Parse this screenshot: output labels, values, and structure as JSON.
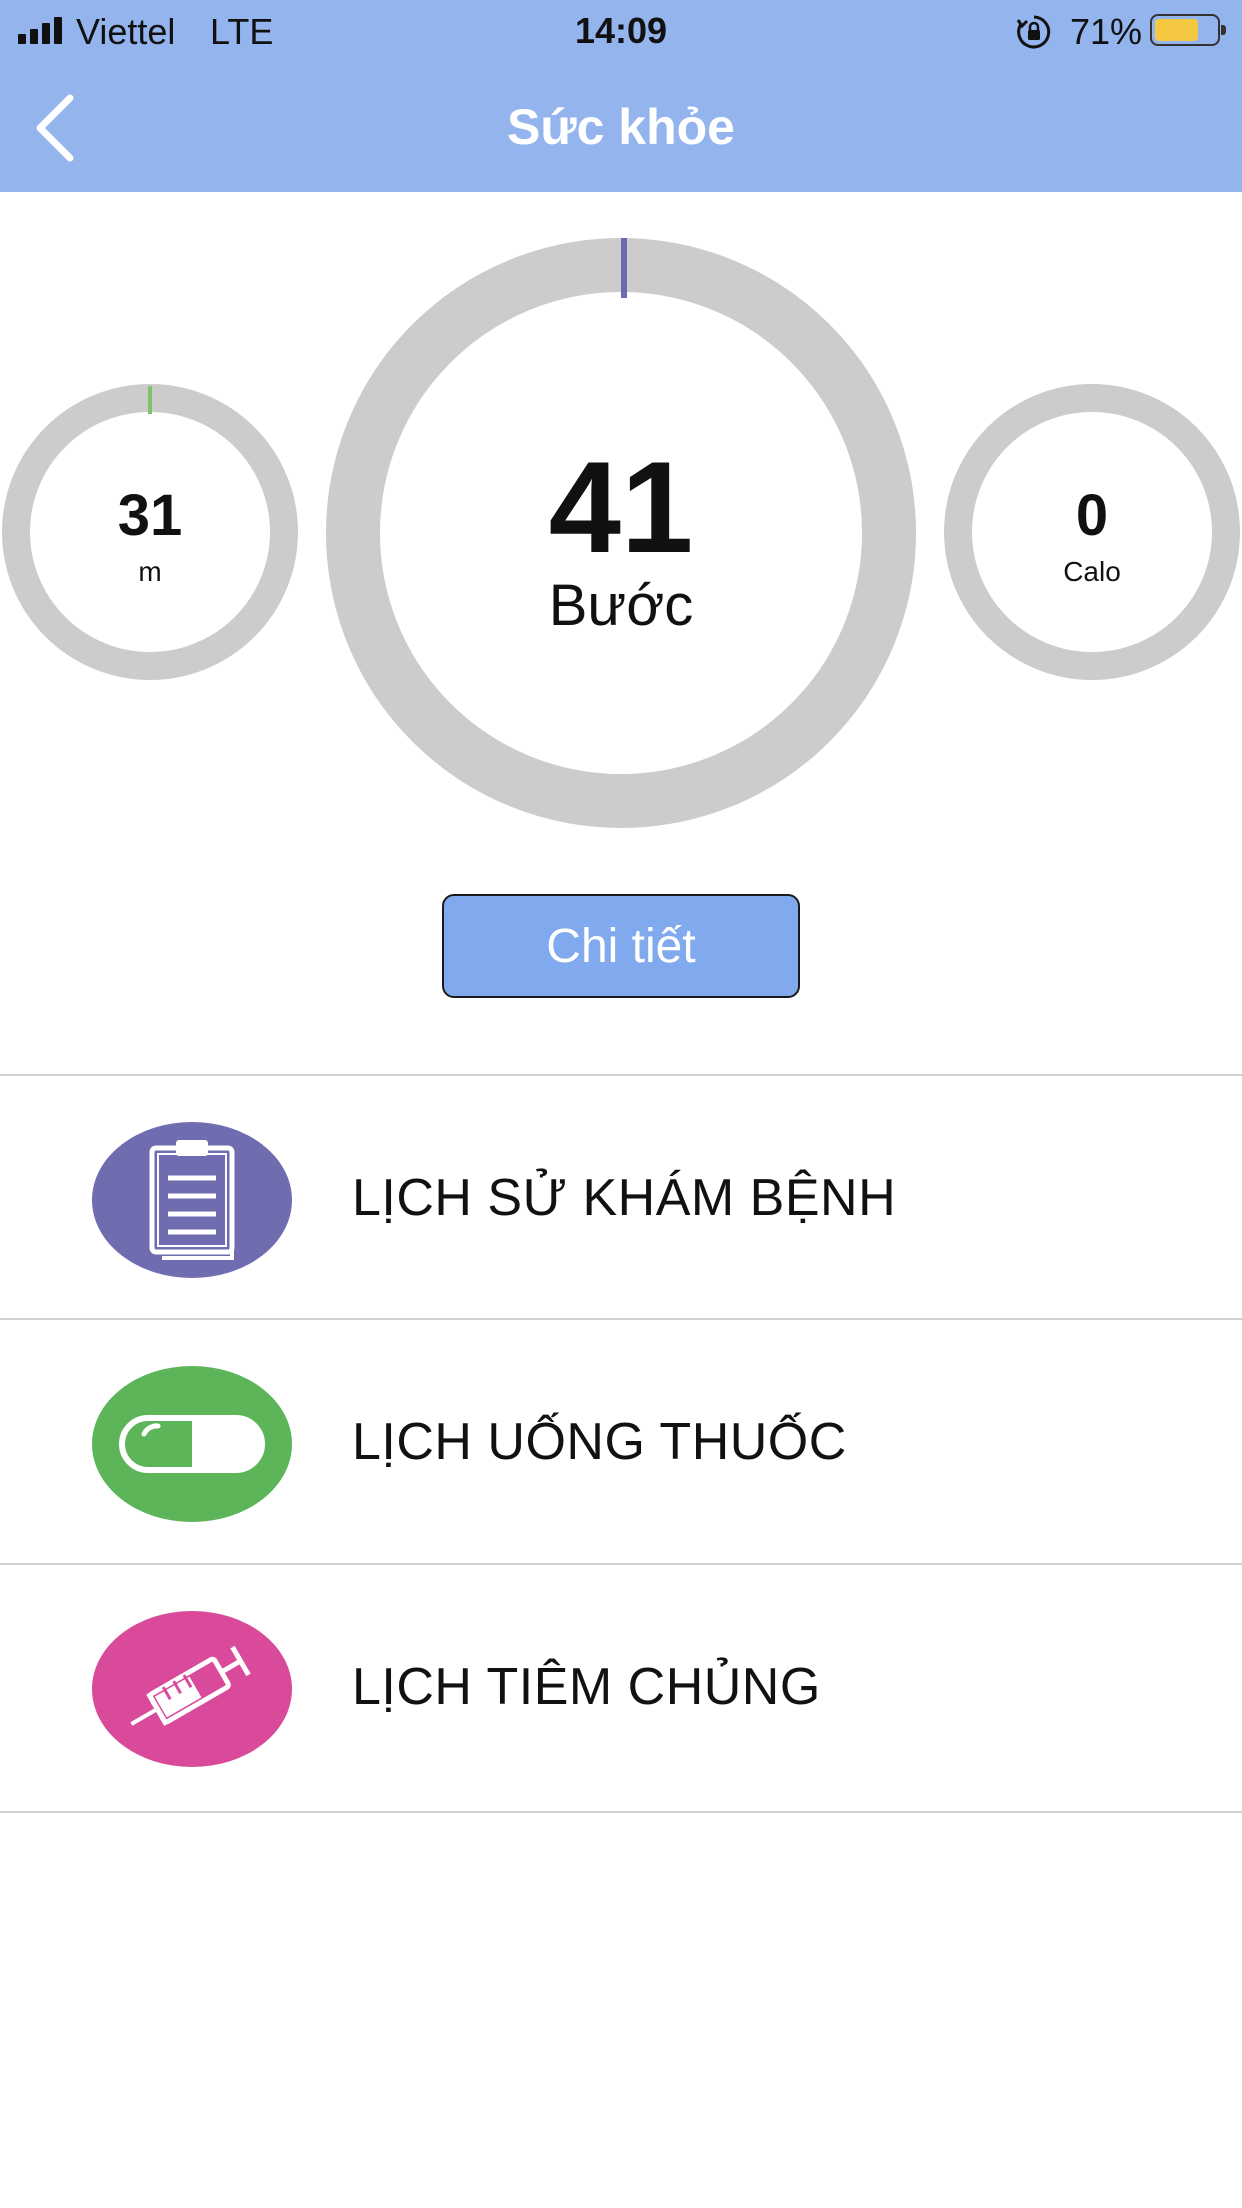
{
  "status_bar": {
    "carrier": "Viettel",
    "network": "LTE",
    "time": "14:09",
    "battery_percent": "71%",
    "battery_level": 0.71,
    "lock_icon": "orientation-lock-icon"
  },
  "nav": {
    "title": "Sức khỏe",
    "back_icon": "chevron-left-icon"
  },
  "stats": {
    "distance": {
      "value": "31",
      "unit": "m",
      "progress": 0.0,
      "accent": "#7cc36b"
    },
    "steps": {
      "value": "41",
      "unit": "Bước",
      "progress": 0.0,
      "accent": "#6b6aab"
    },
    "calories": {
      "value": "0",
      "unit": "Calo",
      "progress": 0.0
    }
  },
  "detail_button": {
    "label": "Chi tiết"
  },
  "menu": [
    {
      "label": "LỊCH SỬ KHÁM BỆNH",
      "icon": "clipboard-icon",
      "color": "#6f6db0"
    },
    {
      "label": "LỊCH UỐNG THUỐC",
      "icon": "pill-icon",
      "color": "#5db55a"
    },
    {
      "label": "LỊCH TIÊM CHỦNG",
      "icon": "syringe-icon",
      "color": "#d94a9a"
    }
  ],
  "colors": {
    "header": "#94b4ee",
    "ring_track": "#cccccc",
    "button": "#80a9ee"
  }
}
